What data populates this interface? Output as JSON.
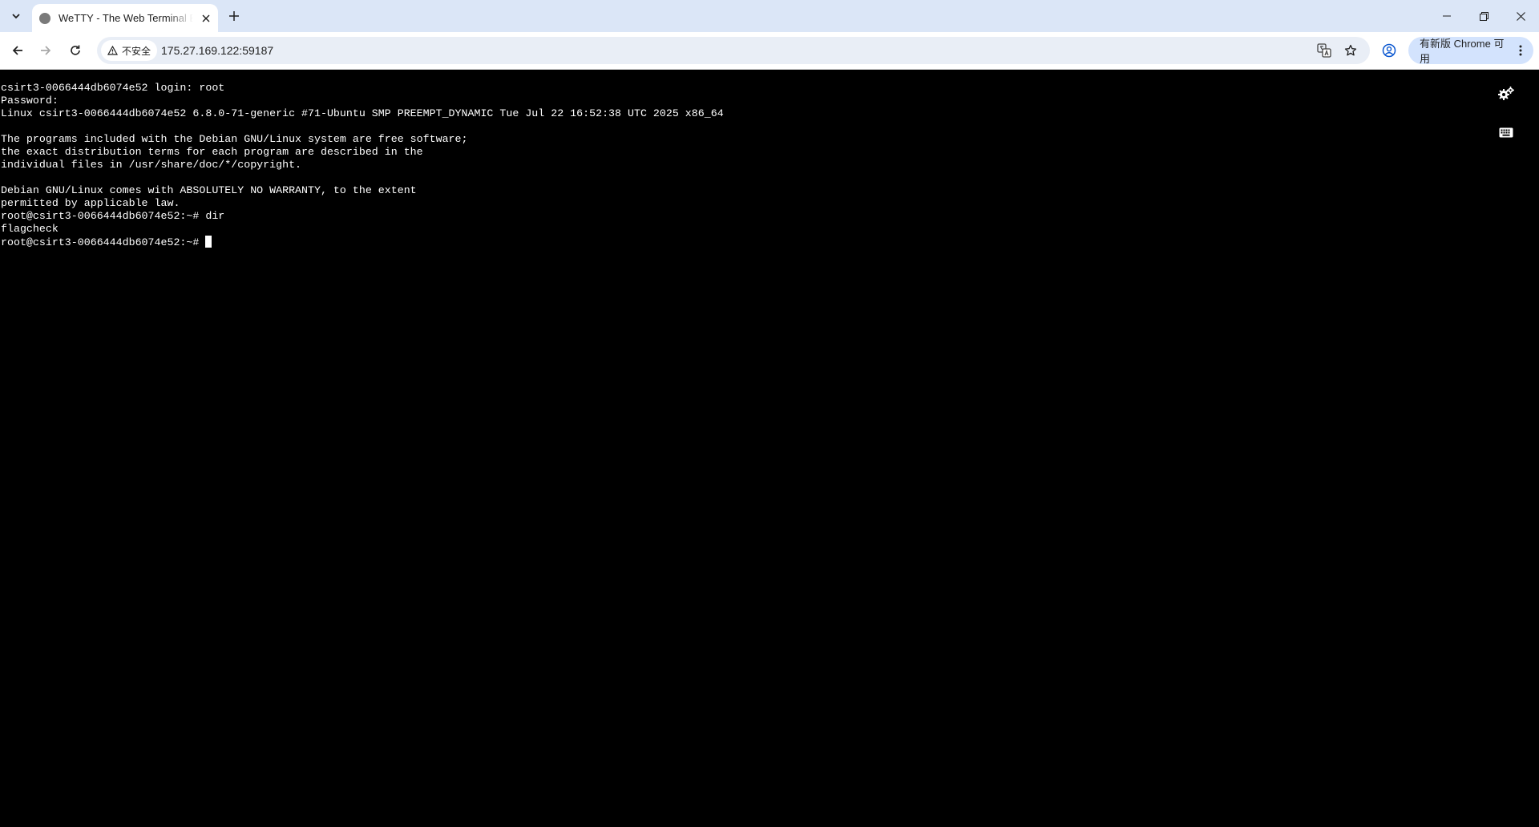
{
  "browser": {
    "tab": {
      "title": "WeTTY - The Web Terminal Emulator"
    },
    "address_bar": {
      "security_label": "不安全",
      "url": "175.27.169.122:59187"
    },
    "update_chip": {
      "label": "有新版 Chrome 可用"
    }
  },
  "terminal": {
    "lines": [
      "csirt3-0066444db6074e52 login: root",
      "Password:",
      "Linux csirt3-0066444db6074e52 6.8.0-71-generic #71-Ubuntu SMP PREEMPT_DYNAMIC Tue Jul 22 16:52:38 UTC 2025 x86_64",
      "",
      "The programs included with the Debian GNU/Linux system are free software;",
      "the exact distribution terms for each program are described in the",
      "individual files in /usr/share/doc/*/copyright.",
      "",
      "Debian GNU/Linux comes with ABSOLUTELY NO WARRANTY, to the extent",
      "permitted by applicable law.",
      "root@csirt3-0066444db6074e52:~# dir",
      "flagcheck"
    ],
    "prompt": "root@csirt3-0066444db6074e52:~# "
  },
  "icons": {
    "tab_search": "chevron-down-icon",
    "favicon": "globe-icon",
    "tab_close": "close-icon",
    "new_tab": "plus-icon",
    "back": "arrow-left-icon",
    "forward": "arrow-right-icon",
    "reload": "reload-icon",
    "security": "warning-triangle-icon",
    "translate": "translate-icon",
    "bookmark": "star-icon",
    "profile": "profile-icon",
    "menu": "vertical-dots-icon",
    "settings": "gears-icon",
    "keyboard": "keyboard-icon"
  },
  "colors": {
    "tabstrip": "#dbe6f7",
    "omnibox": "#e9eef6",
    "update_chip": "#d3e3fd",
    "terminal_bg": "#000000",
    "terminal_fg": "#ffffff"
  }
}
